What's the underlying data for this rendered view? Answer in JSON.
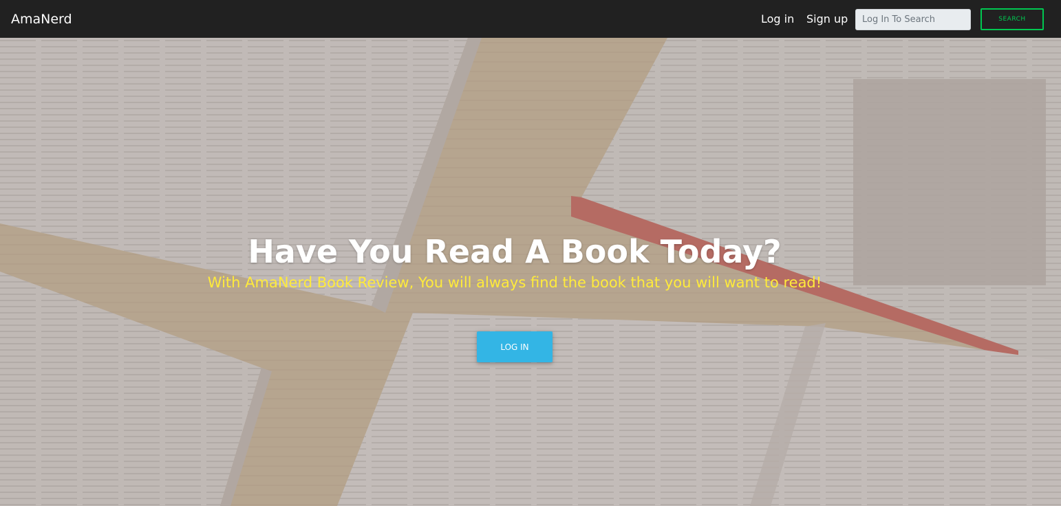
{
  "navbar": {
    "brand": "AmaNerd",
    "login_link": "Log in",
    "signup_link": "Sign up",
    "search": {
      "placeholder": "Log In To Search",
      "value": ""
    },
    "search_button": "SEARCH"
  },
  "hero": {
    "title": "Have You Read A Book Today?",
    "subtitle": "With AmaNerd Book Review, You will always find the book that you will want to read!",
    "button_label": "LOG IN",
    "background_image": "open-books-on-wooden-table"
  },
  "colors": {
    "navbar_bg": "#212121",
    "search_button_border": "#00c851",
    "subtitle": "#ffeb3b",
    "hero_button": "#33b5e5"
  }
}
